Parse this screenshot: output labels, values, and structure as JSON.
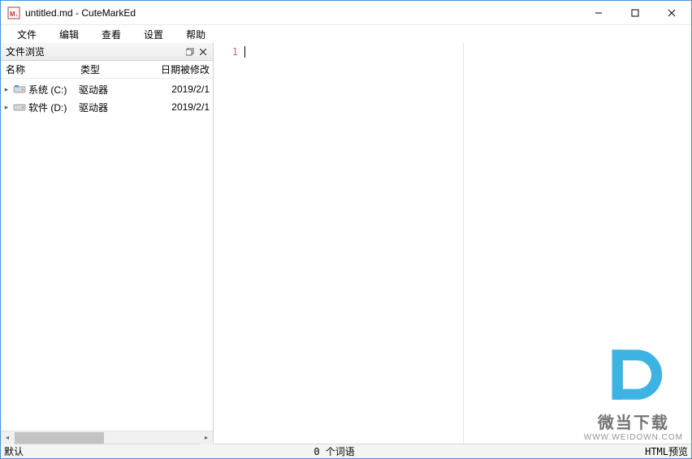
{
  "window": {
    "title": "untitled.md - CuteMarkEd"
  },
  "menubar": [
    "文件",
    "编辑",
    "查看",
    "设置",
    "帮助"
  ],
  "sidebar": {
    "panel_title": "文件浏览",
    "columns": {
      "name": "名称",
      "type": "类型",
      "date": "日期被修改"
    },
    "rows": [
      {
        "name": "系统 (C:)",
        "type": "驱动器",
        "date": "2019/2/1"
      },
      {
        "name": "软件 (D:)",
        "type": "驱动器",
        "date": "2019/2/1"
      }
    ]
  },
  "editor": {
    "line_number": "1",
    "content": ""
  },
  "statusbar": {
    "left": "默认",
    "center": "0 个词语",
    "right": "HTML预览"
  },
  "watermark": {
    "brand": "微当下载",
    "url": "WWW.WEIDOWN.COM"
  }
}
